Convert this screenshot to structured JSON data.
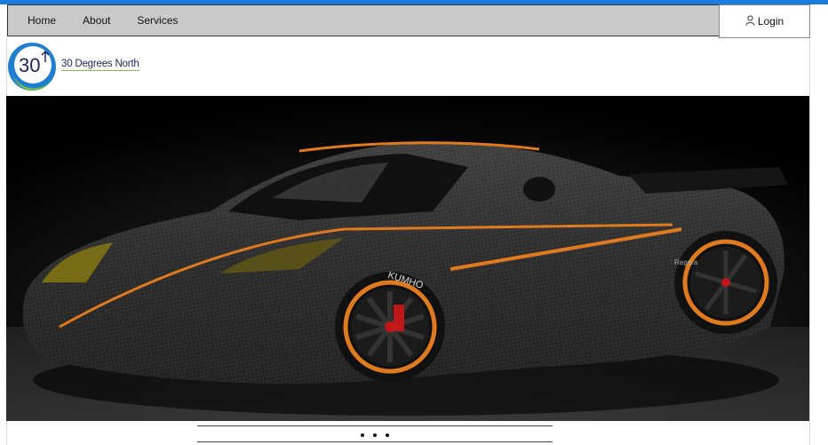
{
  "nav": {
    "items": [
      {
        "label": "Home"
      },
      {
        "label": "About"
      },
      {
        "label": "Services"
      }
    ],
    "login_label": "Login",
    "accent_color": "#1a7be0",
    "bar_color": "#c9c9c9"
  },
  "brand": {
    "logo_text": "30",
    "name": "30 Degrees North",
    "colors": {
      "navy": "#1b2a55",
      "green": "#7fbf3f",
      "blue": "#1e7fd0"
    }
  },
  "hero": {
    "subject": "carbon-fiber sports car with orange accents",
    "tire_text": "KUMHO",
    "badge_text": "Regera"
  },
  "carousel": {
    "slide_count": 3
  }
}
